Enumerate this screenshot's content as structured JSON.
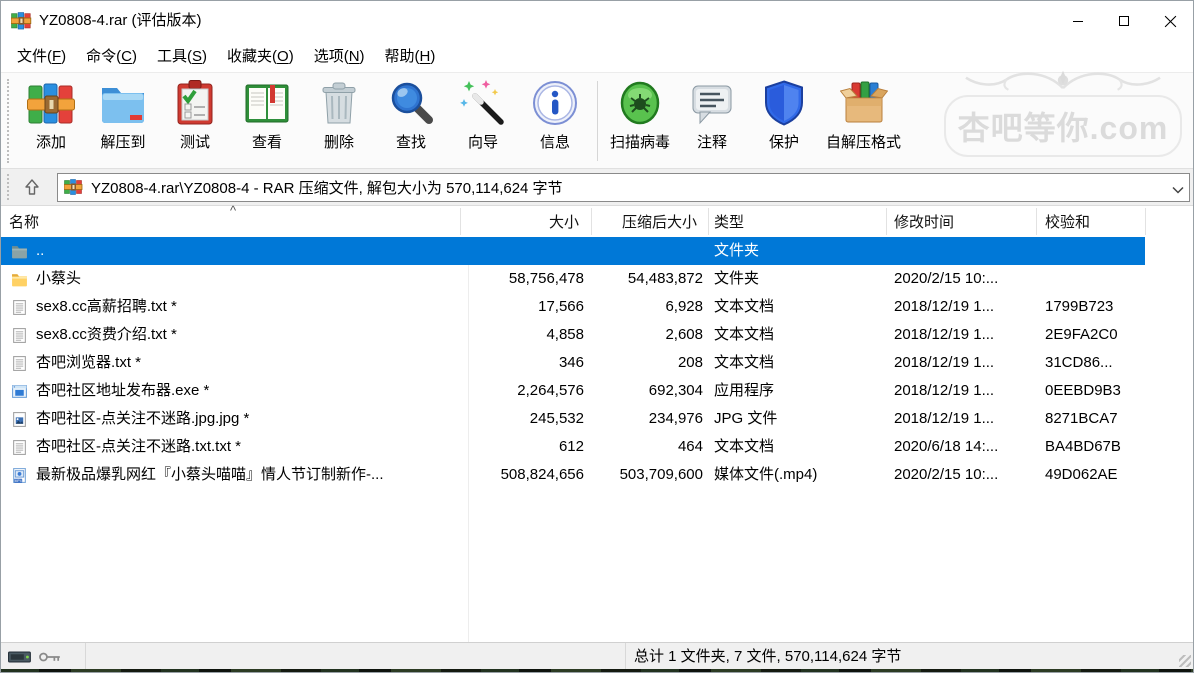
{
  "window": {
    "title": "YZ0808-4.rar (评估版本)"
  },
  "menu": {
    "items": [
      "文件(F)",
      "命令(C)",
      "工具(S)",
      "收藏夹(O)",
      "选项(N)",
      "帮助(H)"
    ]
  },
  "toolbar": {
    "buttons": [
      {
        "label": "添加",
        "icon": "winrar-books-icon"
      },
      {
        "label": "解压到",
        "icon": "extract-folder-icon"
      },
      {
        "label": "测试",
        "icon": "test-clipboard-icon"
      },
      {
        "label": "查看",
        "icon": "view-book-icon"
      },
      {
        "label": "删除",
        "icon": "delete-trash-icon"
      },
      {
        "label": "查找",
        "icon": "find-magnifier-icon"
      },
      {
        "label": "向导",
        "icon": "wizard-wand-icon"
      },
      {
        "label": "信息",
        "icon": "info-circle-icon"
      },
      {
        "separator": true
      },
      {
        "label": "扫描病毒",
        "icon": "virus-scan-icon"
      },
      {
        "label": "注释",
        "icon": "comment-bubble-icon"
      },
      {
        "label": "保护",
        "icon": "protect-shield-icon"
      },
      {
        "label": "自解压格式",
        "icon": "sfx-box-icon"
      }
    ]
  },
  "watermark": {
    "text": "杏吧等你.com"
  },
  "addressbar": {
    "path": "YZ0808-4.rar\\YZ0808-4 - RAR 压缩文件, 解包大小为 570,114,624 字节"
  },
  "filelist": {
    "columns": [
      "名称",
      "大小",
      "压缩后大小",
      "类型",
      "修改时间",
      "校验和"
    ],
    "rows": [
      {
        "name": "..",
        "icon": "folder-up",
        "size": "",
        "packed": "",
        "type": "文件夹",
        "modified": "",
        "checksum": "",
        "selected": true
      },
      {
        "name": "小蔡头",
        "icon": "folder",
        "size": "58,756,478",
        "packed": "54,483,872",
        "type": "文件夹",
        "modified": "2020/2/15 10:...",
        "checksum": ""
      },
      {
        "name": "sex8.cc高薪招聘.txt *",
        "icon": "text",
        "size": "17,566",
        "packed": "6,928",
        "type": "文本文档",
        "modified": "2018/12/19 1...",
        "checksum": "1799B723"
      },
      {
        "name": "sex8.cc资费介绍.txt *",
        "icon": "text",
        "size": "4,858",
        "packed": "2,608",
        "type": "文本文档",
        "modified": "2018/12/19 1...",
        "checksum": "2E9FA2C0"
      },
      {
        "name": "杏吧浏览器.txt *",
        "icon": "text",
        "size": "346",
        "packed": "208",
        "type": "文本文档",
        "modified": "2018/12/19 1...",
        "checksum": "31CD86..."
      },
      {
        "name": "杏吧社区地址发布器.exe *",
        "icon": "exe",
        "size": "2,264,576",
        "packed": "692,304",
        "type": "应用程序",
        "modified": "2018/12/19 1...",
        "checksum": "0EEBD9B3"
      },
      {
        "name": "杏吧社区-点关注不迷路.jpg.jpg *",
        "icon": "jpg",
        "size": "245,532",
        "packed": "234,976",
        "type": "JPG 文件",
        "modified": "2018/12/19 1...",
        "checksum": "8271BCA7"
      },
      {
        "name": "杏吧社区-点关注不迷路.txt.txt *",
        "icon": "text",
        "size": "612",
        "packed": "464",
        "type": "文本文档",
        "modified": "2020/6/18 14:...",
        "checksum": "BA4BD67B"
      },
      {
        "name": "最新极品爆乳网红『小蔡头喵喵』情人节订制新作-...",
        "icon": "mp4",
        "size": "508,824,656",
        "packed": "503,709,600",
        "type": "媒体文件(.mp4)",
        "modified": "2020/2/15 10:...",
        "checksum": "49D062AE"
      }
    ]
  },
  "statusbar": {
    "total": "总计 1 文件夹, 7 文件, 570,114,624 字节"
  }
}
